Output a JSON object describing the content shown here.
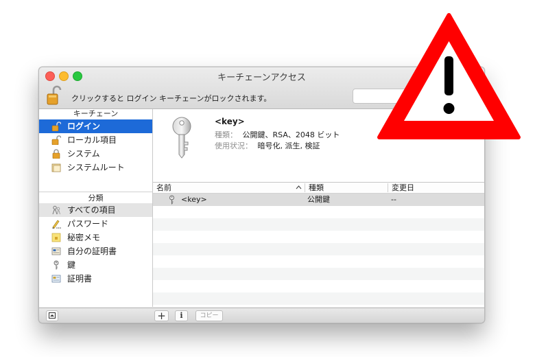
{
  "window": {
    "title": "キーチェーンアクセス",
    "lock_message": "クリックすると ログイン キーチェーンがロックされます。",
    "search_placeholder": ""
  },
  "sidebar": {
    "keychains_header": "キーチェーン",
    "keychains": [
      {
        "label": "ログイン",
        "icon": "unlocked-padlock-icon",
        "selected": true
      },
      {
        "label": "ローカル項目",
        "icon": "unlocked-padlock-icon"
      },
      {
        "label": "システム",
        "icon": "locked-padlock-icon"
      },
      {
        "label": "システムルート",
        "icon": "folder-icon"
      }
    ],
    "categories_header": "分類",
    "categories": [
      {
        "label": "すべての項目",
        "icon": "people-icon",
        "selected": true
      },
      {
        "label": "パスワード",
        "icon": "pencil-icon"
      },
      {
        "label": "秘密メモ",
        "icon": "note-icon"
      },
      {
        "label": "自分の証明書",
        "icon": "my-certificate-icon"
      },
      {
        "label": "鍵",
        "icon": "key-icon"
      },
      {
        "label": "証明書",
        "icon": "certificate-icon"
      }
    ]
  },
  "detail": {
    "name": "<key>",
    "kind_label": "種類：",
    "kind_value": "公開鍵、RSA、2048 ビット",
    "usage_label": "使用状況：",
    "usage_value": "暗号化, 派生, 検証"
  },
  "table": {
    "columns": [
      "名前",
      "種類",
      "変更日"
    ],
    "rows": [
      {
        "name": "<key>",
        "kind": "公開鍵",
        "modified": "--"
      }
    ]
  },
  "bottombar": {
    "add_label": "+",
    "info_label": "i",
    "copy_label": "コピー"
  },
  "colors": {
    "selection_blue": "#1d6ad8",
    "warning_red": "#ff0000"
  }
}
